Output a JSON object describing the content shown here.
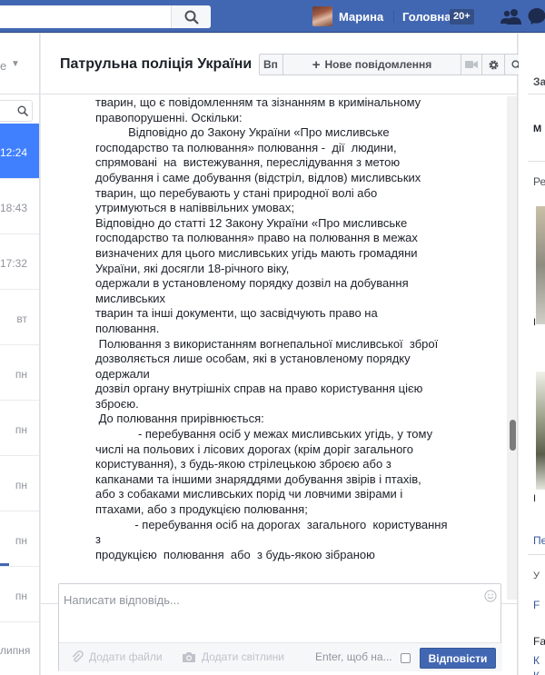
{
  "topbar": {
    "user_name": "Марина",
    "home_label": "Головна",
    "home_badge": "20+"
  },
  "left": {
    "dropdown_label": "е",
    "times": [
      "12:24",
      "18:43",
      "17:32",
      "вт",
      "пн",
      "пн",
      "пн",
      "пн",
      "пн"
    ],
    "bottom_label": "липня"
  },
  "conversation": {
    "title": "Патрульна поліція України",
    "truncated_button": "Вп",
    "new_message_button": "Нове повідомлення",
    "message_lines": [
      "тварин, що є повідомленням та зізнанням в кримінальному",
      "правопорушенні. Оскільки:",
      "          Відповідно до Закону України «Про мисливське",
      "господарство та полювання» полювання -  дії  людини,",
      "спрямовані  на  вистежування, переслідування з метою",
      "добування і саме добування (відстріл, відлов) мисливських",
      "тварин, що перебувають у стані природної волі або",
      "утримуються в напіввільних умовах;",
      "Відповідно до статті 12 Закону України «Про мисливське",
      "господарство та полювання» право на полювання в межах",
      "визначених для цього мисливських угідь мають громадяни",
      "України, які досягли 18-річного віку,",
      "одержали в установленому порядку дозвіл на добування",
      "мисливських",
      "тварин та інші документи, що засвідчують право на",
      "полювання.",
      " Полювання з використанням вогнепальної мисливської  зброї",
      "дозволяється лише особам, які в установленому порядку",
      "одержали",
      "дозвіл органу внутрішніх справ на право користування цією",
      "зброєю.",
      " До полювання прирівнюється:",
      "             - перебування осіб у межах мисливських угідь, у тому",
      "числі на польових і лісових дорогах (крім доріг загального",
      "користування), з будь-якою стрілецькою зброєю або з",
      "капканами та іншими знаряддями добування звірів і птахів,",
      "або з собаками мисливських порід чи ловчими звірами і",
      "птахами, або з продукцією полювання;",
      "            - перебування осіб на дорогах  загального  користування",
      "з",
      "продукцією  полювання  або  з будь-якою зібраною"
    ]
  },
  "composer": {
    "placeholder": "Написати відповідь...",
    "add_files": "Додати файли",
    "add_photos": "Додати світлини",
    "enter_label": "Enter, щоб на...",
    "reply_button": "Відповісти"
  },
  "right": {
    "label_top": "За",
    "label_m": "М",
    "label_re": "Ре",
    "label_i1": "І",
    "label_i2": "І",
    "link_per": "Пер",
    "box_u": "У",
    "box_f": "F",
    "bottom_fa": "Fa",
    "bottom_k1": "К",
    "bottom_k2": "К"
  },
  "colors": {
    "brand": "#4267b2",
    "active_item": "#4080ff",
    "link": "#365899"
  }
}
